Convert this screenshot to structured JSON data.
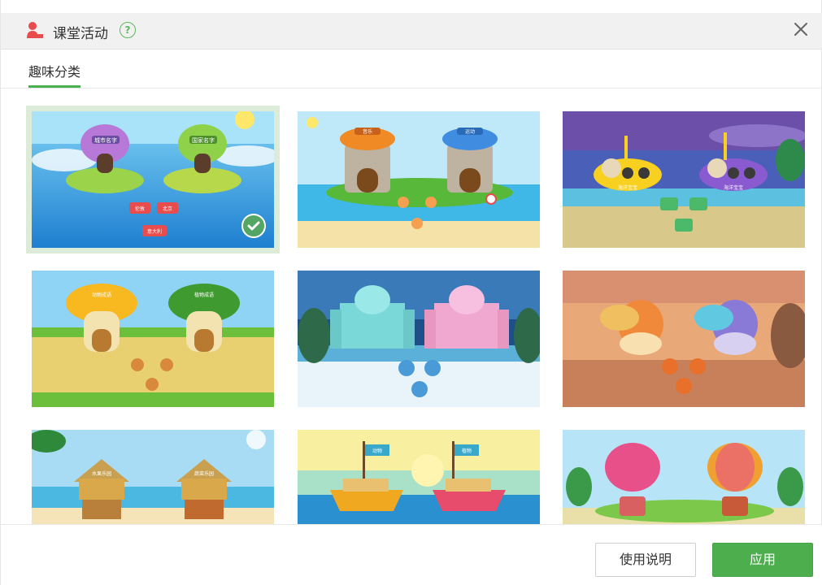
{
  "dialog": {
    "title": "课堂活动",
    "help_icon_glyph": "?",
    "title_icon": "teacher-icon",
    "close_icon": "close-icon"
  },
  "tabs": [
    {
      "label": "趣味分类",
      "active": true
    }
  ],
  "activities": [
    {
      "theme": "islands",
      "labels": [
        "城市名字",
        "国家名字"
      ],
      "chips": [
        "伦敦",
        "北京",
        "意大利"
      ],
      "selected": true
    },
    {
      "theme": "towers",
      "labels": [
        "音乐",
        "运动"
      ],
      "chips": [
        "",
        "",
        ""
      ],
      "selected": false
    },
    {
      "theme": "submarines",
      "labels": [
        "海洋宝宝",
        "海洋宝宝"
      ],
      "chips": [
        "",
        "",
        ""
      ],
      "selected": false
    },
    {
      "theme": "mushrooms",
      "labels": [
        "动物成语",
        "植物成语"
      ],
      "chips": [
        "",
        "",
        ""
      ],
      "selected": false
    },
    {
      "theme": "ice-castles",
      "labels": [
        "",
        ""
      ],
      "chips": [
        "",
        "",
        ""
      ],
      "selected": false
    },
    {
      "theme": "dragons",
      "labels": [
        "",
        ""
      ],
      "chips": [
        "",
        "",
        ""
      ],
      "selected": false
    },
    {
      "theme": "huts",
      "labels": [
        "水果乐园",
        "蔬菜乐园"
      ],
      "chips": [],
      "selected": false
    },
    {
      "theme": "boats",
      "labels": [
        "动物",
        "植物"
      ],
      "chips": [],
      "selected": false
    },
    {
      "theme": "balloons",
      "labels": [
        "",
        ""
      ],
      "chips": [],
      "selected": false
    }
  ],
  "footer": {
    "help_label": "使用说明",
    "apply_label": "应用"
  },
  "colors": {
    "accent": "#4cae4c",
    "selected_outline": "#dcecd8"
  }
}
